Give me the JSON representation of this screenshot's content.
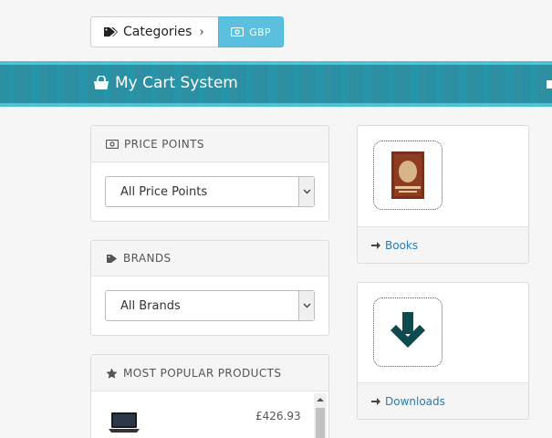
{
  "toolbar": {
    "categories_label": "Categories",
    "currency_label": "GBP"
  },
  "banner": {
    "title": "My Cart System"
  },
  "price_panel": {
    "heading": "PRICE POINTS",
    "selected": "All Price Points"
  },
  "brands_panel": {
    "heading": "BRANDS",
    "selected": "All Brands"
  },
  "popular_panel": {
    "heading": "MOST POPULAR PRODUCTS",
    "products": [
      {
        "price": "£426.93"
      }
    ]
  },
  "category_cards": [
    {
      "label": "Books"
    },
    {
      "label": "Downloads"
    }
  ],
  "colors": {
    "accent": "#5bc0de",
    "banner": "#2a8fa3",
    "link": "#2a7bb5",
    "download_arrow": "#0f4a50"
  }
}
